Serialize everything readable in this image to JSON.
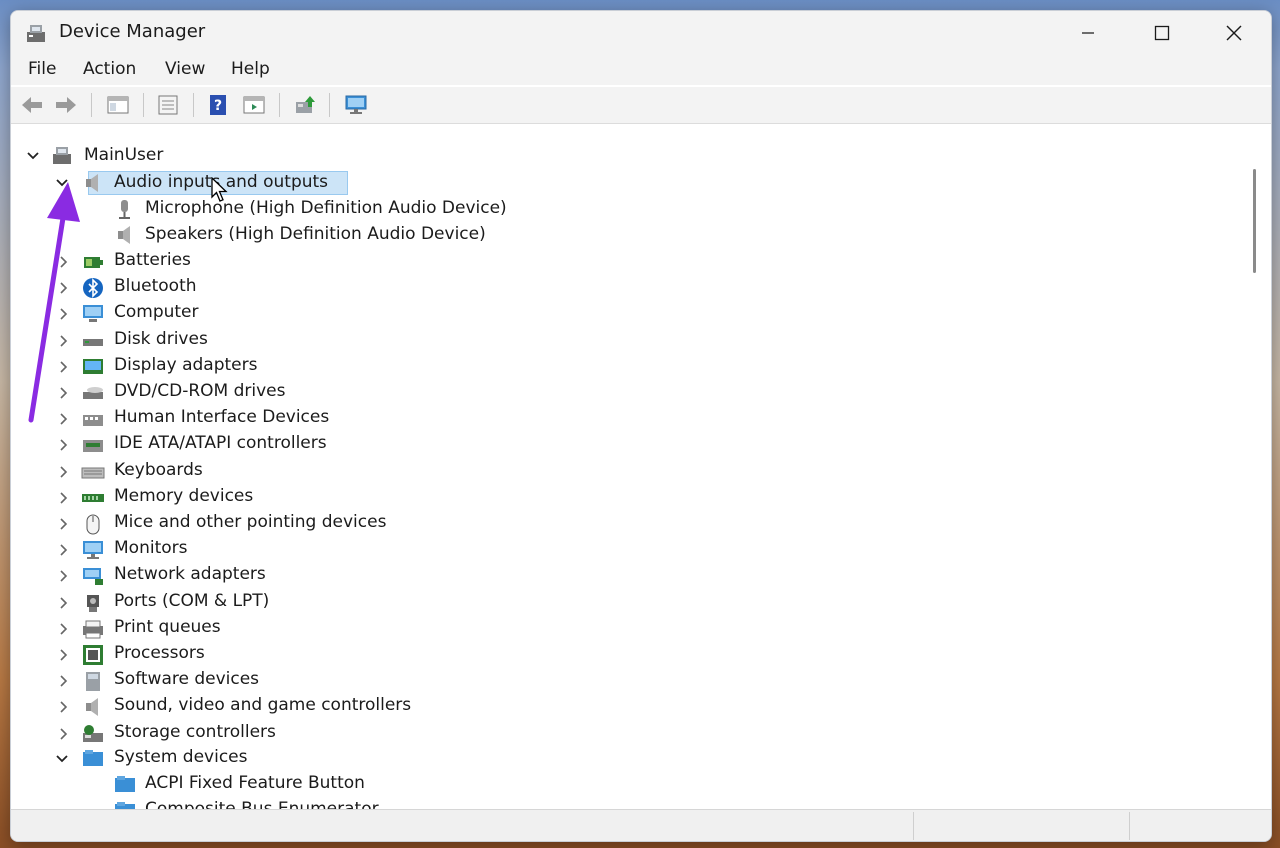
{
  "window": {
    "title": "Device Manager"
  },
  "menu": [
    "File",
    "Action",
    "View",
    "Help"
  ],
  "toolbar": {
    "buttons": [
      "back-icon",
      "forward-icon",
      "console-tree-icon",
      "properties-icon",
      "help-icon",
      "view-icon",
      "update-driver-icon",
      "monitor-icon"
    ]
  },
  "tree": {
    "root": "MainUser",
    "audio": {
      "label": "Audio inputs and outputs",
      "children": [
        "Microphone (High Definition Audio Device)",
        "Speakers (High Definition Audio Device)"
      ]
    },
    "categories": [
      "Batteries",
      "Bluetooth",
      "Computer",
      "Disk drives",
      "Display adapters",
      "DVD/CD-ROM drives",
      "Human Interface Devices",
      "IDE ATA/ATAPI controllers",
      "Keyboards",
      "Memory devices",
      "Mice and other pointing devices",
      "Monitors",
      "Network adapters",
      "Ports (COM & LPT)",
      "Print queues",
      "Processors",
      "Software devices",
      "Sound, video and game controllers",
      "Storage controllers"
    ],
    "system": {
      "label": "System devices",
      "children": [
        "ACPI Fixed Feature Button",
        "Composite Bus Enumerator"
      ]
    }
  },
  "colors": {
    "selection": "#cce4f7",
    "annotation_arrow": "#8a2be2"
  }
}
